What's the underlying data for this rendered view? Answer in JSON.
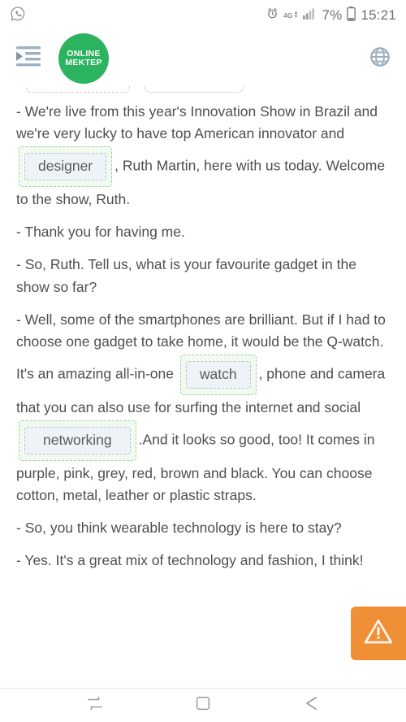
{
  "status_bar": {
    "notification_icon": "whatsapp-icon",
    "alarm_icon": "alarm-clock-icon",
    "network_label": "4G",
    "signal_icon": "signal-bars-icon",
    "battery_percent": "7%",
    "battery_icon": "battery-icon",
    "time": "15:21"
  },
  "header": {
    "menu_icon": "indent-menu-icon",
    "logo_line1": "ONLINE",
    "logo_line2": "MEKTEP",
    "language_icon": "globe-icon"
  },
  "word_bank": {
    "chips": [
      {
        "label": "",
        "style": "dashed"
      },
      {
        "label": "",
        "style": "solid"
      }
    ]
  },
  "passage": {
    "paragraphs": [
      {
        "id": "p1",
        "segments": [
          {
            "type": "text",
            "value": "- We're live from this year's Innovation Show in Brazil and we're very lucky to have top American innovator and "
          },
          {
            "type": "dropzone",
            "value": "designer"
          },
          {
            "type": "text",
            "value": ", Ruth Martin, here with us today. Welcome to the show, Ruth."
          }
        ]
      },
      {
        "id": "p2",
        "segments": [
          {
            "type": "text",
            "value": "- Thank you for having me."
          }
        ]
      },
      {
        "id": "p3",
        "segments": [
          {
            "type": "text",
            "value": "- So, Ruth. Tell us, what is your favourite gadget in the show so far?"
          }
        ]
      },
      {
        "id": "p4",
        "segments": [
          {
            "type": "text",
            "value": "- Well, some of the smartphones are brilliant. But if I had to choose one gadget to take home, it would be the Q-watch. It's an amazing all-in-one "
          },
          {
            "type": "dropzone",
            "value": "watch"
          },
          {
            "type": "text",
            "value": ", phone and camera that you can also use for surfing the internet and social "
          },
          {
            "type": "dropzone",
            "value": "networking"
          },
          {
            "type": "text",
            "value": ".And it looks so good, too! It comes in purple, pink, grey, red, brown and black. You can choose cotton, metal, leather or plastic straps."
          }
        ]
      },
      {
        "id": "p5",
        "segments": [
          {
            "type": "text",
            "value": "- So, you think wearable technology is here to stay?"
          }
        ]
      },
      {
        "id": "p6",
        "segments": [
          {
            "type": "text",
            "value": "- Yes. It's a great mix of technology and fashion, I think!"
          }
        ]
      }
    ],
    "p1_before": "- We're live from this year's Innovation Show in Brazil and we're very lucky to have top American innovator and ",
    "p1_drop": "designer",
    "p1_after": ", Ruth Martin, here with us today. Welcome to the show, Ruth.",
    "p2_text": "- Thank you for having me.",
    "p3_text": "- So, Ruth. Tell us, what is your favourite gadget in the show so far?",
    "p4_before": "- Well, some of the smartphones are brilliant. But if I had to choose one gadget to take home, it would be the Q-watch. It's an amazing all-in-one ",
    "p4_drop1": "watch",
    "p4_middle": ", phone and camera that you can also use for surfing the internet and social ",
    "p4_drop2": "networking",
    "p4_after": ".And it looks so good, too! It comes in purple, pink, grey, red, brown and black. You can choose cotton, metal, leather or plastic straps.",
    "p5_text": "- So, you think wearable technology is here to stay?",
    "p6_text": "- Yes. It's a great mix of technology and fashion, I think!"
  },
  "warning_button": {
    "icon": "warning-triangle-icon",
    "color": "#ef8f36"
  },
  "nav_bar": {
    "recents_icon": "recents-icon",
    "home_icon": "home-square-icon",
    "back_icon": "back-arrow-icon"
  },
  "colors": {
    "brand_green": "#2bb35f",
    "dropzone_border": "#9ed29e",
    "dropzone_fill": "#f1faf1",
    "slot_fill": "#eef3f7",
    "warning_orange": "#ef8f36",
    "text": "#4f4f4f"
  }
}
